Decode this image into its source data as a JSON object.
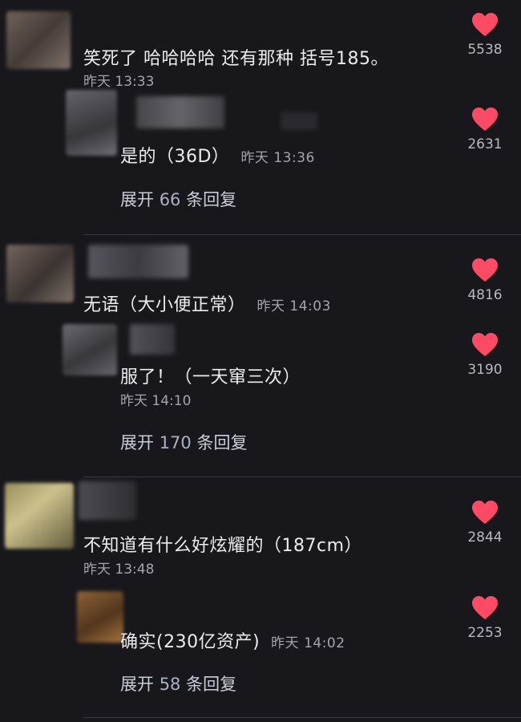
{
  "theme": {
    "background": "#18181c",
    "heart": "#fe4a64",
    "divider": "#3a3a42"
  },
  "threads": [
    {
      "comment": {
        "text": "笑死了 哈哈哈哈 还有那种 括号185。",
        "time": "昨天 13:33",
        "likes": "5538"
      },
      "reply": {
        "text": "是的（36D）",
        "time": "昨天 13:36",
        "likes": "2631"
      },
      "expand": {
        "prefix": "展开 ",
        "count": "66",
        "suffix": " 条回复"
      }
    },
    {
      "comment": {
        "text": "无语（大小便正常）",
        "time": "昨天 14:03",
        "likes": "4816"
      },
      "reply": {
        "text": "服了！（一天窜三次）",
        "time": "昨天 14:10",
        "likes": "3190"
      },
      "expand": {
        "prefix": "展开 ",
        "count": "170",
        "suffix": " 条回复"
      }
    },
    {
      "comment": {
        "text": "不知道有什么好炫耀的（187cm）",
        "time": "昨天 13:48",
        "likes": "2844"
      },
      "reply": {
        "text": "确实(230亿资产)",
        "time": "昨天 14:02",
        "likes": "2253"
      },
      "expand": {
        "prefix": "展开 ",
        "count": "58",
        "suffix": " 条回复"
      }
    }
  ]
}
